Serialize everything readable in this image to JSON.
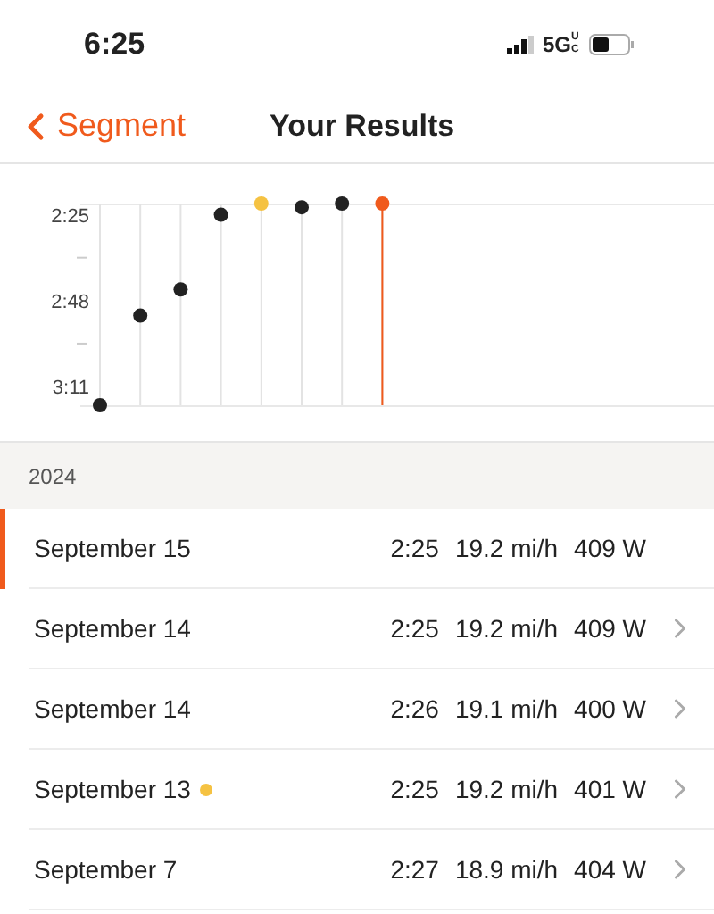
{
  "status_bar": {
    "time": "6:25",
    "network": "5G",
    "network_suffix": "UC"
  },
  "nav": {
    "back_label": "Segment",
    "title": "Your Results"
  },
  "chart": {
    "chart_data": {
      "type": "scatter",
      "categories": [
        null,
        null,
        null,
        null,
        null,
        null,
        null,
        null
      ],
      "ylim": [
        196,
        142
      ],
      "grid": true,
      "yticks": [
        {
          "value": 145,
          "label": "2:25"
        },
        {
          "value": 168,
          "label": "2:48"
        },
        {
          "value": 191,
          "label": "3:11"
        }
      ],
      "series": [
        {
          "color": "#222222",
          "values": [
            196,
            172,
            165,
            145,
            null,
            143,
            142,
            null
          ]
        },
        {
          "color": "#f5c242",
          "values": [
            null,
            null,
            null,
            null,
            142,
            null,
            null,
            null
          ]
        },
        {
          "color": "#f05a1c",
          "values": [
            null,
            null,
            null,
            null,
            null,
            null,
            null,
            142
          ]
        }
      ]
    }
  },
  "section": {
    "title": "2024"
  },
  "rows": [
    {
      "date": "September 15",
      "time": "2:25",
      "speed": "19.2 mi/h",
      "power": "409 W",
      "selected": true
    },
    {
      "date": "September 14",
      "time": "2:25",
      "speed": "19.2 mi/h",
      "power": "409 W",
      "selected": false
    },
    {
      "date": "September 14",
      "time": "2:26",
      "speed": "19.1 mi/h",
      "power": "400 W",
      "selected": false
    },
    {
      "date": "September 13",
      "time": "2:25",
      "speed": "19.2 mi/h",
      "power": "401 W",
      "selected": false,
      "color": "#f5c242"
    },
    {
      "date": "September 7",
      "time": "2:27",
      "speed": "18.9 mi/h",
      "power": "404 W",
      "selected": false
    }
  ]
}
